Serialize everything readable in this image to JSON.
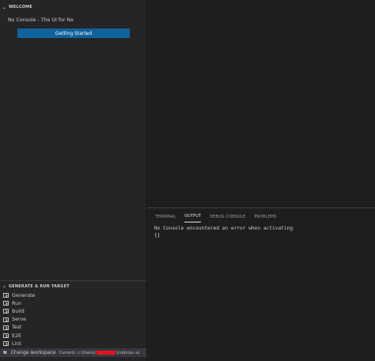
{
  "sidebar": {
    "welcome": {
      "header": "WELCOME",
      "subtitle": "Nx Console - The UI for Nx",
      "button_label": "Getting Started"
    },
    "generate": {
      "header": "GENERATE & RUN TARGET",
      "items": [
        {
          "label": "Generate",
          "icon": "terminal-icon"
        },
        {
          "label": "Run",
          "icon": "terminal-icon"
        },
        {
          "label": "Build",
          "icon": "terminal-icon"
        },
        {
          "label": "Serve",
          "icon": "terminal-icon"
        },
        {
          "label": "Test",
          "icon": "terminal-icon"
        },
        {
          "label": "E2E",
          "icon": "terminal-icon"
        },
        {
          "label": "Lint",
          "icon": "terminal-icon"
        }
      ],
      "workspace": {
        "icon": "N",
        "label": "Change workspace",
        "current_prefix": "Current: c:\\Users\\",
        "current_suffix": "\\code\\ac-ui"
      }
    }
  },
  "panel": {
    "tabs": [
      {
        "label": "TERMINAL",
        "active": false
      },
      {
        "label": "OUTPUT",
        "active": true
      },
      {
        "label": "DEBUG CONSOLE",
        "active": false
      },
      {
        "label": "PROBLEMS",
        "active": false
      }
    ],
    "output_lines": [
      "Nx Console encountered an error when activating",
      "{}"
    ]
  },
  "colors": {
    "sidebar_bg": "#252526",
    "editor_bg": "#1e1e1e",
    "button_bg": "#0e639c",
    "redaction": "#e81123"
  }
}
